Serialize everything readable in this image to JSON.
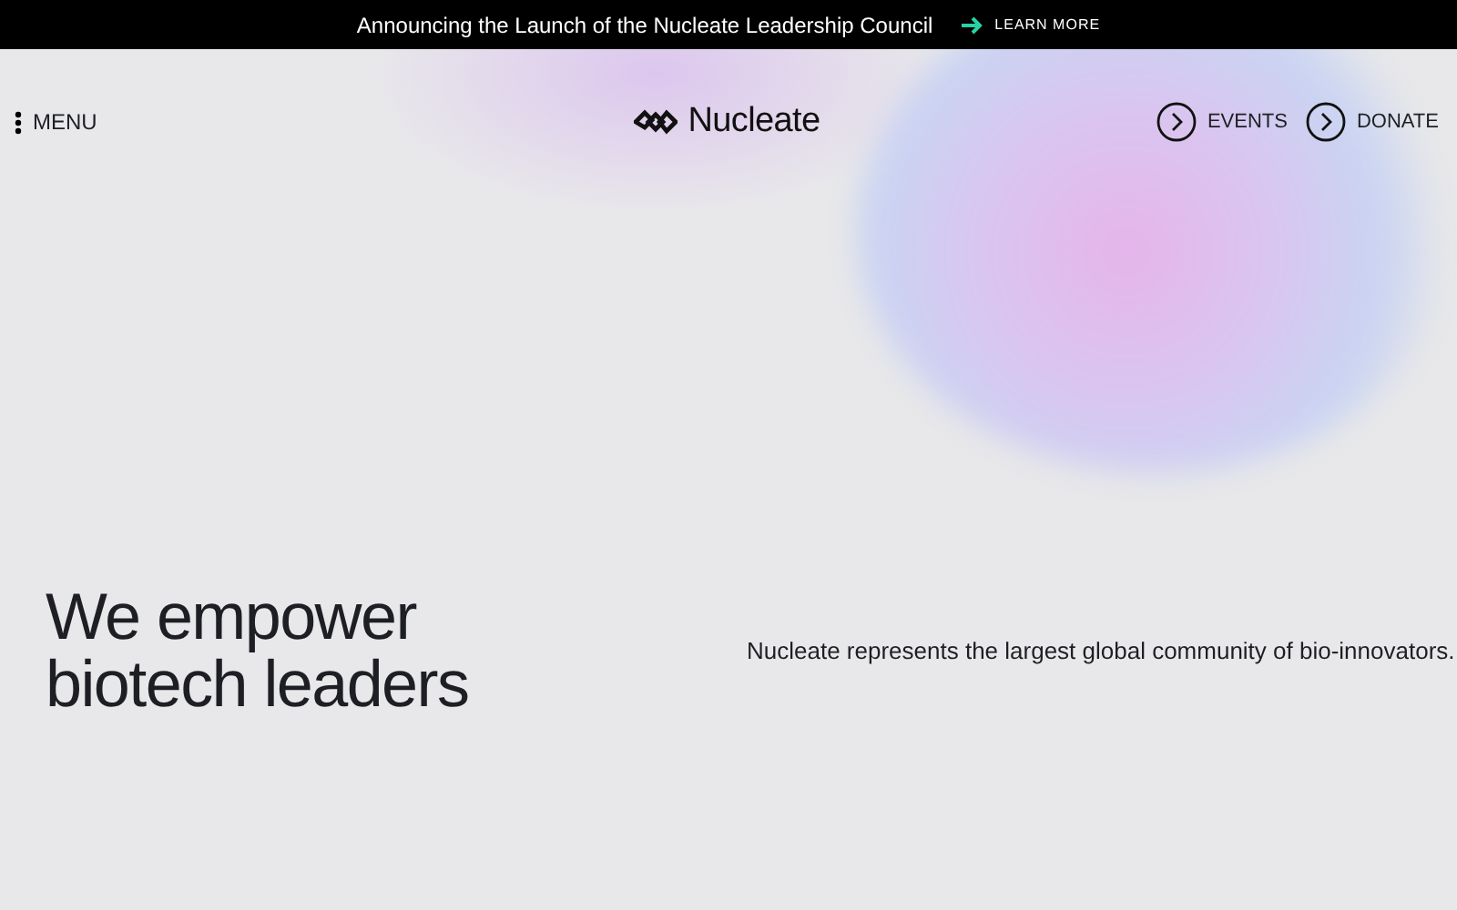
{
  "announcement": {
    "text": "Announcing the Launch of the Nucleate Leadership Council",
    "link": "LEARN MORE"
  },
  "header": {
    "menu": "MENU",
    "logo": "Nucleate",
    "actions": [
      "EVENTS",
      "DONATE"
    ]
  },
  "hero": {
    "headline": "We empower biotech leaders",
    "tagline": "Nucleate represents the largest global community of bio-innovators."
  }
}
